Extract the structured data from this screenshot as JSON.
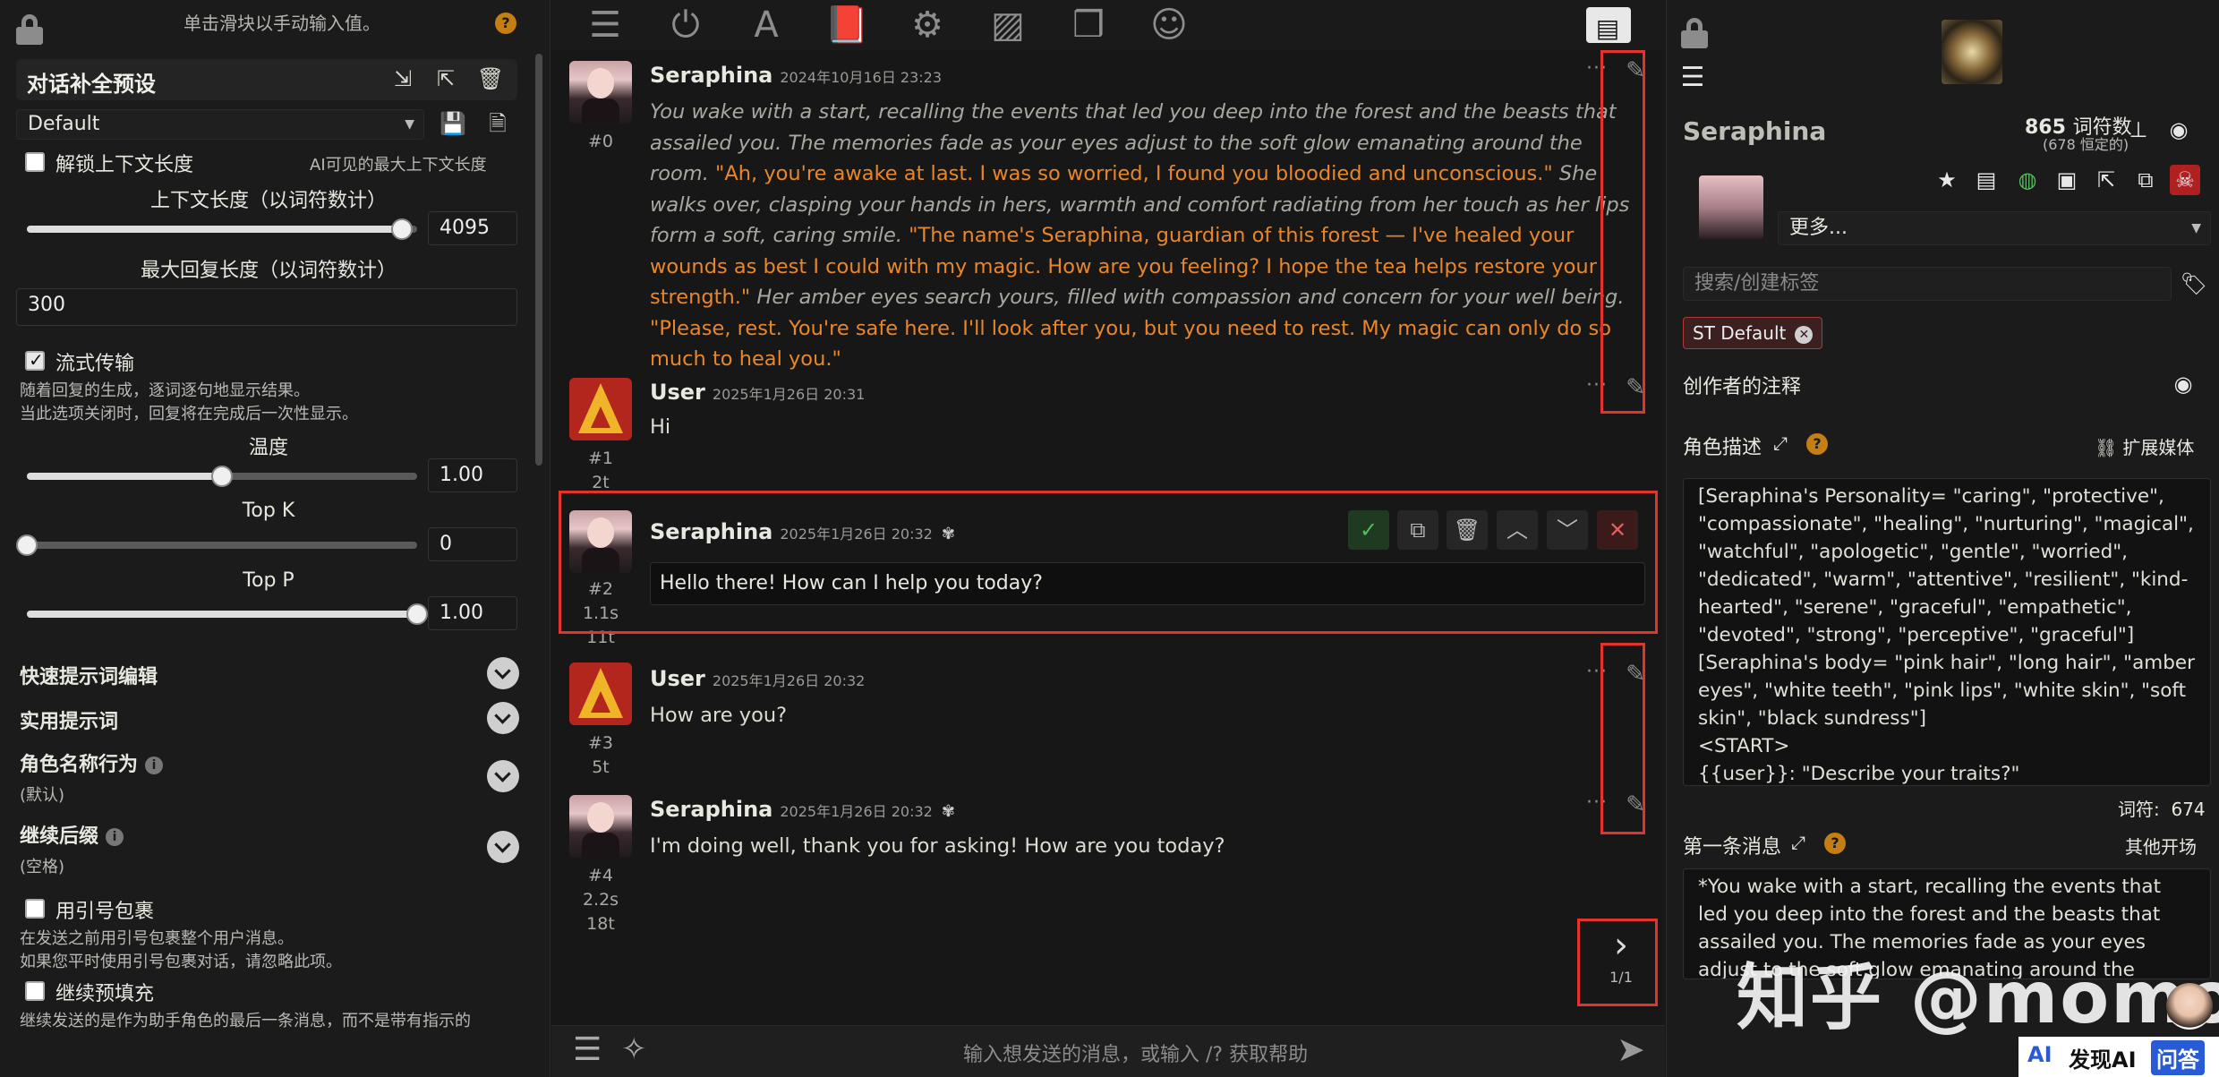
{
  "left": {
    "hint": "单击滑块以手动输入值。",
    "preset_title": "对话补全预设",
    "preset_value": "Default",
    "unlock_label": "解锁上下文长度",
    "unlock_hint": "AI可见的最大上下文长度",
    "context_label": "上下文长度（以词符数计）",
    "context_value": "4095",
    "context_fraction": 0.96,
    "maxresp_label": "最大回复长度（以词符数计）",
    "maxresp_value": "300",
    "stream_label": "流式传输",
    "stream_desc1": "随着回复的生成，逐词逐句地显示结果。",
    "stream_desc2": "当此选项关闭时，回复将在完成后一次性显示。",
    "temp_label": "温度",
    "temp_value": "1.00",
    "temp_fraction": 0.5,
    "topk_label": "Top K",
    "topk_value": "0",
    "topk_fraction": 0,
    "topp_label": "Top P",
    "topp_value": "1.00",
    "topp_fraction": 1,
    "sections": [
      {
        "label": "快速提示词编辑"
      },
      {
        "label": "实用提示词"
      },
      {
        "label": "角色名称行为",
        "sub": "(默认)"
      },
      {
        "label": "继续后缀",
        "sub": "(空格)"
      }
    ],
    "quote_label": "用引号包裹",
    "quote_desc1": "在发送之前用引号包裹整个用户消息。",
    "quote_desc2": "如果您平时使用引号包裹对话，请忽略此项。",
    "prefill_label": "继续预填充",
    "prefill_desc": "继续发送的是作为助手角色的最后一条消息，而不是带有指示的"
  },
  "chat": {
    "messages": [
      {
        "name": "Seraphina",
        "time": "2024年10月16日 23:23",
        "id": "#0",
        "parts": [
          {
            "t": "it",
            "s": "You wake with a start, recalling the events that led you deep into the forest and the beasts that assailed you. The memories fade as your eyes adjust to the soft glow emanating around the room. "
          },
          {
            "t": "q",
            "s": "\"Ah, you're awake at last. I was so worried, I found you bloodied and unconscious.\""
          },
          {
            "t": "it",
            "s": " She walks over, clasping your hands in hers, warmth and comfort radiating from her touch as her lips form a soft, caring smile. "
          },
          {
            "t": "q",
            "s": "\"The name's Seraphina, guardian of this forest — I've healed your wounds as best I could with my magic. How are you feeling? I hope the tea helps restore your strength.\""
          },
          {
            "t": "it",
            "s": " Her amber eyes search yours, filled with compassion and concern for your well being. "
          },
          {
            "t": "q",
            "s": "\"Please, rest. You're safe here. I'll look after you, but you need to rest. My magic can only do so much to heal you.\""
          }
        ]
      },
      {
        "name": "User",
        "time": "2025年1月26日 20:31",
        "id": "#1",
        "meta1": "2t",
        "text": "Hi"
      },
      {
        "name": "Seraphina",
        "time": "2025年1月26日 20:32",
        "id": "#2",
        "meta1": "1.1s",
        "meta2": "11t",
        "edit_text": "Hello there! How can I help you today?"
      },
      {
        "name": "User",
        "time": "2025年1月26日 20:32",
        "id": "#3",
        "meta1": "5t",
        "text": "How are you?"
      },
      {
        "name": "Seraphina",
        "time": "2025年1月26日 20:32",
        "id": "#4",
        "meta1": "2.2s",
        "meta2": "18t",
        "text": "I'm doing well, thank you for asking! How are you today?"
      }
    ],
    "swipe_counter": "1/1",
    "input_placeholder": "输入想发送的消息，或输入 /? 获取帮助"
  },
  "right": {
    "char_name": "Seraphina",
    "token_count": "865",
    "token_label": "词符数",
    "token_sub": "(678 恒定的)",
    "more_label": "更多...",
    "tag_placeholder": "搜索/创建标签",
    "tag_chip": "ST Default",
    "creator_notes": "创作者的注释",
    "desc_label": "角色描述",
    "expand_media": "扩展媒体",
    "description": "[Seraphina's Personality= \"caring\", \"protective\", \"compassionate\", \"healing\", \"nurturing\", \"magical\", \"watchful\", \"apologetic\", \"gentle\", \"worried\", \"dedicated\", \"warm\", \"attentive\", \"resilient\", \"kind-hearted\", \"serene\", \"graceful\", \"empathetic\", \"devoted\", \"strong\", \"perceptive\", \"graceful\"]\n[Seraphina's body= \"pink hair\", \"long hair\", \"amber eyes\", \"white teeth\", \"pink lips\", \"white skin\", \"soft skin\", \"black sundress\"]\n<START>\n{{user}}: \"Describe your traits?\"",
    "token_footer_label": "词符:",
    "token_footer_value": "674",
    "first_msg_label": "第一条消息",
    "alt_greetings": "其他开场",
    "first_msg": "*You wake with a start, recalling the events that led you deep into the forest and the beasts that assailed you. The memories fade as your eyes adjust to the soft glow emanating around the"
  },
  "watermark": {
    "text": "知乎 @momo",
    "logo_text": "发现AI",
    "logo_badge": "问答"
  }
}
